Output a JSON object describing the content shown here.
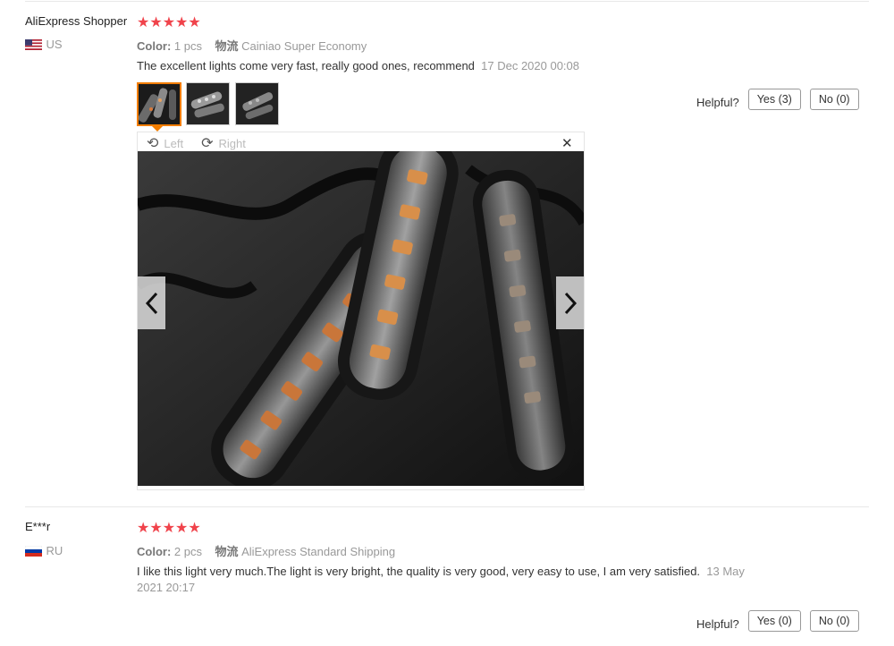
{
  "reviews": [
    {
      "user": "AliExpress Shopper",
      "country": "US",
      "rating": "★★★★★",
      "color_label": "Color:",
      "color_value": "1 pcs",
      "logistics_label": "物流",
      "logistics_value": "Cainiao Super Economy",
      "text": "The excellent lights come very fast, really good ones, recommend",
      "date": "17 Dec 2020 00:08",
      "helpful_label": "Helpful?",
      "yes_label": "Yes (3)",
      "no_label": "No (0)"
    },
    {
      "user": "E***r",
      "country": "RU",
      "rating": "★★★★★",
      "color_label": "Color:",
      "color_value": "2 pcs",
      "logistics_label": "物流",
      "logistics_value": "AliExpress Standard Shipping",
      "text": "I like this light very much.The light is very bright, the quality is very good, very easy to use, I am very satisfied.",
      "date": "13 May 2021 20:17",
      "helpful_label": "Helpful?",
      "yes_label": "Yes (0)",
      "no_label": "No (0)"
    }
  ],
  "viewer": {
    "rotate_left": "Left",
    "rotate_right": "Right",
    "close_icon": "close-icon",
    "prev_icon": "chevron-left-icon",
    "next_icon": "chevron-right-icon"
  },
  "colors": {
    "star": "#f0434b",
    "active_thumb_border": "#f27d00"
  }
}
